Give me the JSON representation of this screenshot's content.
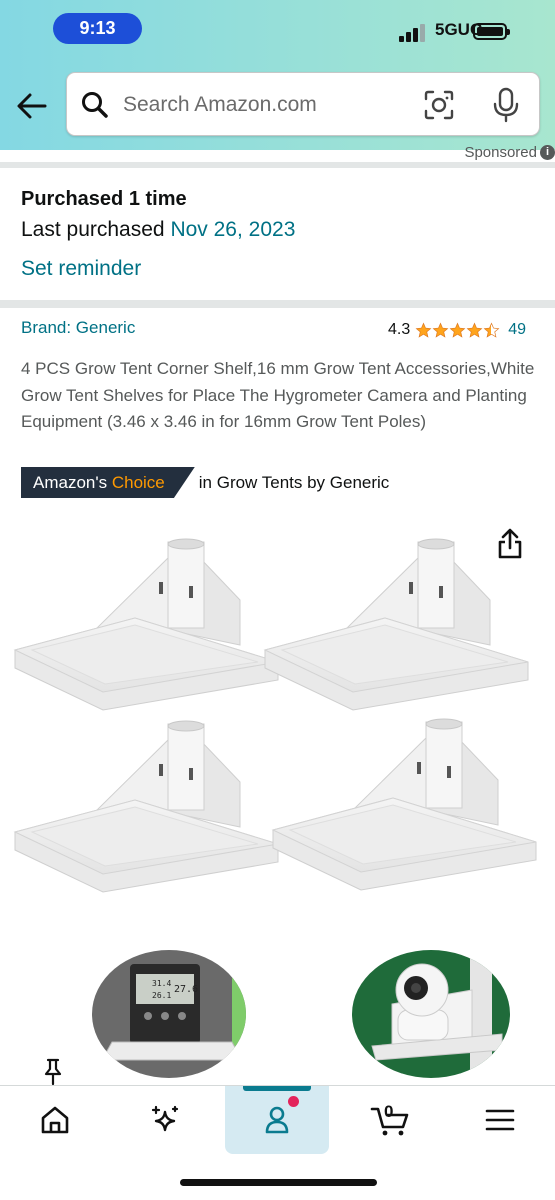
{
  "status_bar": {
    "time": "9:13",
    "network": "5GUC"
  },
  "search": {
    "placeholder": "Search Amazon.com"
  },
  "sponsored": {
    "label": "Sponsored",
    "info_icon": "info-icon"
  },
  "purchase_history": {
    "times": "Purchased 1 time",
    "last_label": "Last purchased",
    "last_date": "Nov 26, 2023",
    "reminder": "Set reminder"
  },
  "product": {
    "brand": "Brand: Generic",
    "rating": "4.3",
    "rating_value": 4.3,
    "rating_max": 5,
    "review_count": "49",
    "title": "4 PCS Grow Tent Corner Shelf,16 mm Grow Tent Accessories,White Grow Tent Shelves for Place The Hygrometer Camera and Planting Equipment (3.46 x 3.46 in for 16mm Grow Tent Poles)",
    "badge_prefix": "Amazon's",
    "badge_highlight": "Choice",
    "badge_category": "in Grow Tents by Generic",
    "hygrometer_readings": [
      "31.4",
      "27.6",
      "26.1"
    ]
  },
  "tabbar": {
    "items": [
      {
        "name": "home",
        "icon": "home-icon"
      },
      {
        "name": "rufus",
        "icon": "sparkle-icon"
      },
      {
        "name": "account",
        "icon": "account-icon",
        "active": true
      },
      {
        "name": "cart",
        "icon": "cart-icon"
      },
      {
        "name": "menu",
        "icon": "menu-icon"
      }
    ],
    "cart_count": "0"
  },
  "colors": {
    "link": "#007185",
    "badge_bg": "#232f3e",
    "badge_orange": "#ff9900",
    "star": "#ffa41c",
    "active_tab": "#0a7b8f",
    "notification_dot": "#e3245b"
  }
}
